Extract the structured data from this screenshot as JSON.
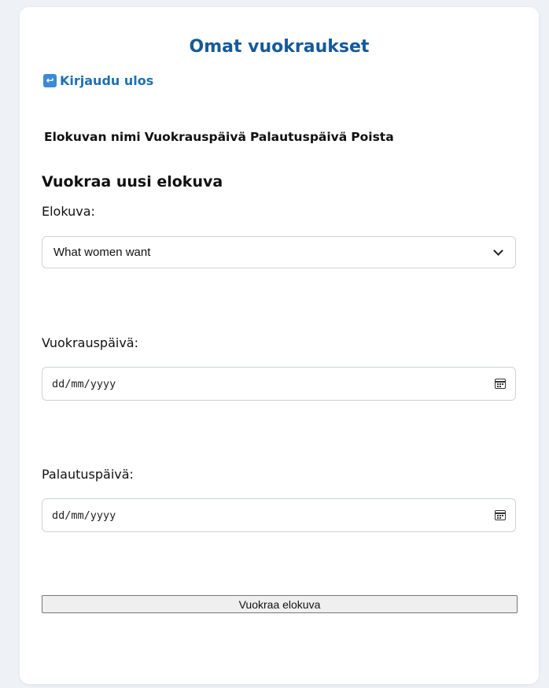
{
  "page": {
    "title": "Omat vuokraukset",
    "logout_label": "Kirjaudu ulos",
    "logout_icon": "return-arrow-icon"
  },
  "rentals_table": {
    "columns": [
      "Elokuvan nimi",
      "Vuokrauspäivä",
      "Palautuspäivä",
      "Poista"
    ],
    "rows": []
  },
  "form": {
    "heading": "Vuokraa uusi elokuva",
    "movie_label": "Elokuva:",
    "movie_selected": "What women want",
    "rent_date_label": "Vuokrauspäivä:",
    "rent_date_placeholder": "dd/mm/yyyy",
    "return_date_label": "Palautuspäivä:",
    "return_date_placeholder": "dd/mm/yyyy",
    "submit_label": "Vuokraa elokuva"
  },
  "colors": {
    "accent": "#15599a",
    "link": "#1d70b7",
    "background": "#eef1f6"
  }
}
